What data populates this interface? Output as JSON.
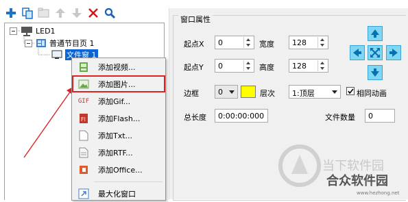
{
  "toolbar": {
    "icons": [
      "add-icon",
      "copy-icon",
      "folder-icon",
      "move-up-icon",
      "move-down-icon",
      "delete-icon",
      "search-icon"
    ]
  },
  "tree": {
    "led_label": "LED1",
    "program_label": "普通节目页 1",
    "window_label": "文件窗 1"
  },
  "menu": {
    "items": [
      {
        "label": "添加视频...",
        "icon": "video-file-icon"
      },
      {
        "label": "添加图片...",
        "icon": "image-icon"
      },
      {
        "label": "添加Gif...",
        "icon": "gif-icon"
      },
      {
        "label": "添加Flash...",
        "icon": "flash-icon"
      },
      {
        "label": "添加Txt...",
        "icon": "txt-file-icon"
      },
      {
        "label": "添加RTF...",
        "icon": "rtf-file-icon"
      },
      {
        "label": "添加Office...",
        "icon": "office-icon"
      },
      {
        "label": "最大化窗口",
        "icon": "maximize-icon"
      }
    ]
  },
  "props": {
    "group_title": "窗口属性",
    "start_x_label": "起点X",
    "start_x_value": "0",
    "width_label": "宽度",
    "width_value": "128",
    "start_y_label": "起点Y",
    "start_y_value": "0",
    "height_label": "高度",
    "height_value": "128",
    "border_label": "边框",
    "border_value": "0",
    "border_color": "#ffff00",
    "layer_label": "层次",
    "layer_value": "1:顶层",
    "sync_label": "相同动画",
    "sync_checked": true,
    "total_length_label": "总长度",
    "total_length_value": "0:00:00:000",
    "file_count_label": "文件数量",
    "file_count_value": "0"
  },
  "watermark": {
    "line1": "当下软件园",
    "line2": "合众软件园",
    "url": "www.hezhong.net"
  },
  "accent_color": "#0a64d6",
  "highlight_color": "#dd2222"
}
